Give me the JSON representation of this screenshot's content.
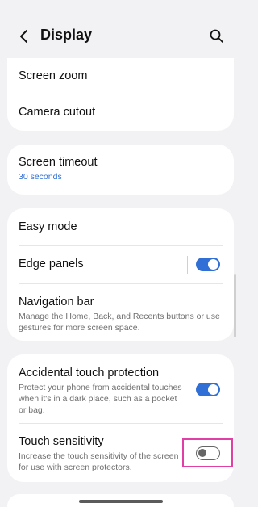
{
  "header": {
    "title": "Display",
    "back_icon": "back-arrow-icon",
    "search_icon": "search-icon"
  },
  "group1": {
    "items": [
      {
        "label": "Screen zoom"
      },
      {
        "label": "Camera cutout"
      }
    ]
  },
  "group2": {
    "screen_timeout": {
      "label": "Screen timeout",
      "value": "30 seconds"
    }
  },
  "group3": {
    "easy_mode": {
      "label": "Easy mode"
    },
    "edge_panels": {
      "label": "Edge panels",
      "toggle": "on"
    },
    "navigation_bar": {
      "label": "Navigation bar",
      "description": "Manage the Home, Back, and Recents buttons or use gestures for more screen space."
    }
  },
  "group4": {
    "accidental_touch": {
      "label": "Accidental touch protection",
      "description": "Protect your phone from accidental touches when it's in a dark place, such as a pocket or bag.",
      "toggle": "on"
    },
    "touch_sensitivity": {
      "label": "Touch sensitivity",
      "description": "Increase the touch sensitivity of the screen for use with screen protectors.",
      "toggle": "off"
    }
  },
  "colors": {
    "accent": "#2f6fd6",
    "highlight": "#e23fa6",
    "background": "#f2f2f4"
  }
}
